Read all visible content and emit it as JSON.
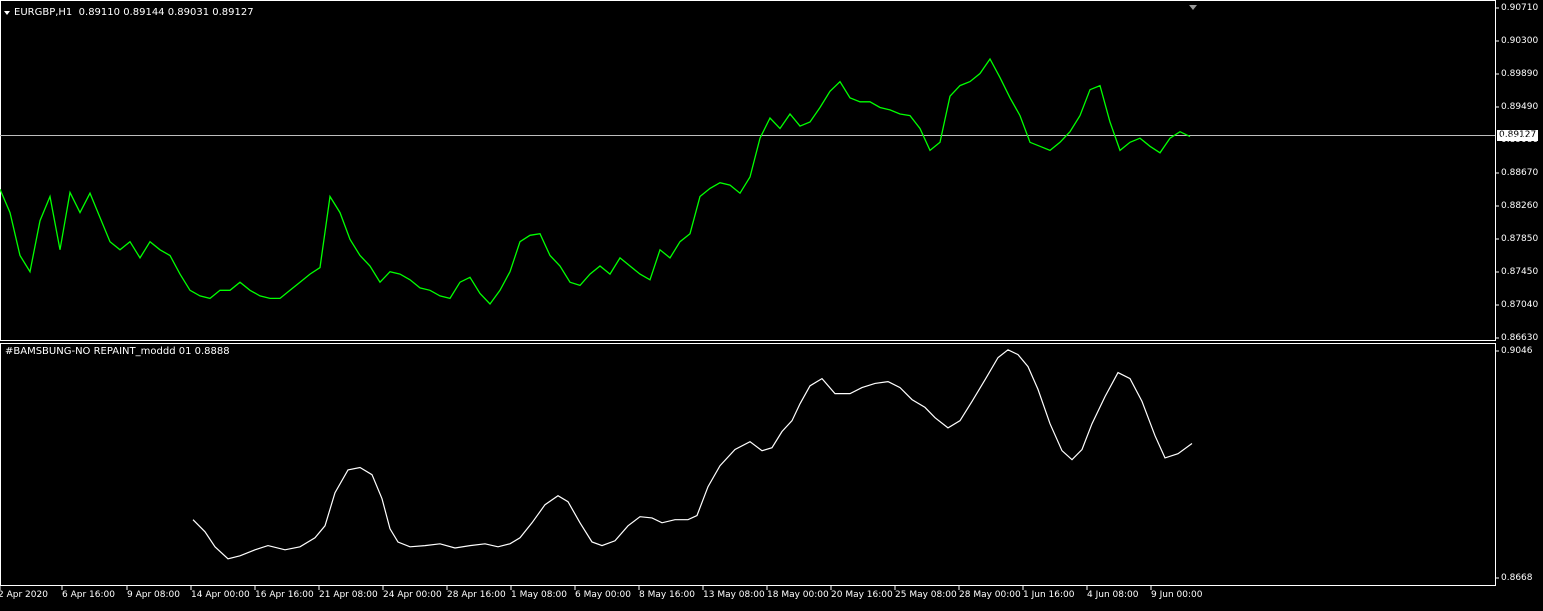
{
  "main_chart": {
    "symbol_tf": "EURGBP,H1",
    "ohlc": "0.89110 0.89144 0.89031 0.89127",
    "current_price": "0.89127",
    "colors": {
      "series": "#00ff00",
      "bg": "#000000",
      "grid": "#ffffff"
    }
  },
  "indicator": {
    "title": "#BAMSBUNG-NO REPAINT_moddd 01 0.8888",
    "color": "#ffffff"
  },
  "chart_data": [
    {
      "type": "line",
      "title": "EURGBP,H1",
      "ylim": [
        0.8663,
        0.9071
      ],
      "yticks": [
        "0.90710",
        "0.90300",
        "0.89890",
        "0.89490",
        "0.89080",
        "0.88670",
        "0.88260",
        "0.87850",
        "0.87450",
        "0.87040",
        "0.86630"
      ],
      "series": [
        {
          "name": "EURGBP,H1",
          "x": [
            0,
            10,
            20,
            30,
            40,
            50,
            60,
            70,
            80,
            90,
            100,
            110,
            120,
            130,
            140,
            150,
            160,
            170,
            180,
            190,
            200,
            210,
            220,
            230,
            240,
            250,
            260,
            270,
            280,
            290,
            300,
            310,
            320,
            330,
            340,
            350,
            360,
            370,
            380,
            390,
            400,
            410,
            420,
            430,
            440,
            450,
            460,
            470,
            480,
            490,
            500,
            510,
            520,
            530,
            540,
            550,
            560,
            570,
            580,
            590,
            600,
            610,
            620,
            630,
            640,
            650,
            660,
            670,
            680,
            690,
            700,
            710,
            720,
            730,
            740,
            750,
            760,
            770,
            780,
            790,
            800,
            810,
            820,
            830,
            840,
            850,
            860,
            870,
            880,
            890,
            900,
            910,
            920,
            930,
            940,
            950,
            960,
            970,
            980,
            990,
            1000,
            1010,
            1020,
            1030,
            1040,
            1050,
            1060,
            1070,
            1080,
            1090,
            1100,
            1110,
            1120,
            1130,
            1140,
            1150,
            1160,
            1170,
            1180,
            1190
          ],
          "values": [
            0.8847,
            0.8818,
            0.8765,
            0.8745,
            0.8808,
            0.8838,
            0.8772,
            0.8843,
            0.8818,
            0.8842,
            0.8812,
            0.8782,
            0.8772,
            0.8782,
            0.8762,
            0.8782,
            0.8772,
            0.8765,
            0.8742,
            0.8722,
            0.8715,
            0.8712,
            0.8722,
            0.8722,
            0.8732,
            0.8722,
            0.8715,
            0.8712,
            0.8712,
            0.8722,
            0.8732,
            0.8742,
            0.875,
            0.8838,
            0.8818,
            0.8785,
            0.8765,
            0.8752,
            0.8732,
            0.8745,
            0.8742,
            0.8735,
            0.8725,
            0.8722,
            0.8715,
            0.8712,
            0.8732,
            0.8738,
            0.8718,
            0.8705,
            0.8722,
            0.8745,
            0.8782,
            0.879,
            0.8792,
            0.8765,
            0.8752,
            0.8732,
            0.8728,
            0.8742,
            0.8752,
            0.8742,
            0.8762,
            0.8752,
            0.8742,
            0.8735,
            0.8772,
            0.8762,
            0.8782,
            0.8792,
            0.8838,
            0.8848,
            0.8855,
            0.8852,
            0.8842,
            0.8862,
            0.891,
            0.8935,
            0.8922,
            0.894,
            0.8925,
            0.893,
            0.8948,
            0.8968,
            0.898,
            0.896,
            0.8955,
            0.8955,
            0.8948,
            0.8945,
            0.894,
            0.8938,
            0.8922,
            0.8895,
            0.8905,
            0.8962,
            0.8975,
            0.898,
            0.899,
            0.9008,
            0.8985,
            0.896,
            0.8938,
            0.8905,
            0.89,
            0.8895,
            0.8905,
            0.8918,
            0.8938,
            0.897,
            0.8975,
            0.893,
            0.8895,
            0.8905,
            0.891,
            0.89,
            0.8892,
            0.891,
            0.8918,
            0.8912
          ]
        }
      ]
    },
    {
      "type": "line",
      "title": "#BAMSBUNG-NO REPAINT_moddd 01 0.8888",
      "ylim": [
        0.8668,
        0.9046
      ],
      "yticks": [
        "0.9046",
        "0.8668"
      ],
      "xticks": [
        "2 Apr 2020",
        "6 Apr 16:00",
        "9 Apr 08:00",
        "14 Apr 00:00",
        "16 Apr 16:00",
        "21 Apr 08:00",
        "24 Apr 00:00",
        "28 Apr 16:00",
        "1 May 08:00",
        "6 May 00:00",
        "8 May 16:00",
        "13 May 08:00",
        "18 May 00:00",
        "20 May 16:00",
        "25 May 08:00",
        "28 May 00:00",
        "1 Jun 16:00",
        "4 Jun 08:00",
        "9 Jun 00:00"
      ],
      "series": [
        {
          "name": "#BAMSBUNG-NO REPAINT_moddd 01",
          "x": [
            193,
            205,
            215,
            228,
            240,
            255,
            268,
            285,
            300,
            315,
            325,
            335,
            348,
            360,
            372,
            382,
            390,
            398,
            410,
            425,
            440,
            455,
            470,
            485,
            498,
            510,
            520,
            532,
            545,
            558,
            568,
            580,
            592,
            602,
            615,
            628,
            640,
            652,
            662,
            675,
            688,
            697,
            708,
            720,
            735,
            750,
            762,
            772,
            782,
            792,
            800,
            810,
            822,
            835,
            850,
            862,
            875,
            888,
            900,
            912,
            925,
            935,
            948,
            960,
            972,
            985,
            998,
            1008,
            1018,
            1028,
            1038,
            1050,
            1062,
            1072,
            1082,
            1092,
            1105,
            1118,
            1130,
            1142,
            1155,
            1165,
            1178,
            1192
          ],
          "values": [
            0.8765,
            0.8745,
            0.872,
            0.87,
            0.8705,
            0.8715,
            0.8722,
            0.8715,
            0.872,
            0.8735,
            0.8755,
            0.881,
            0.8848,
            0.8852,
            0.884,
            0.88,
            0.875,
            0.8728,
            0.872,
            0.8722,
            0.8725,
            0.8718,
            0.8722,
            0.8725,
            0.872,
            0.8725,
            0.8735,
            0.876,
            0.879,
            0.8805,
            0.8795,
            0.876,
            0.8728,
            0.8722,
            0.873,
            0.8755,
            0.877,
            0.8768,
            0.876,
            0.8765,
            0.8765,
            0.8772,
            0.882,
            0.8855,
            0.8882,
            0.8895,
            0.888,
            0.8885,
            0.8912,
            0.893,
            0.8958,
            0.8988,
            0.9,
            0.8975,
            0.8975,
            0.8985,
            0.8992,
            0.8995,
            0.8985,
            0.8965,
            0.8952,
            0.8935,
            0.8918,
            0.893,
            0.8962,
            0.8998,
            0.9035,
            0.9048,
            0.904,
            0.902,
            0.8982,
            0.8925,
            0.888,
            0.8865,
            0.8882,
            0.8925,
            0.897,
            0.901,
            0.9,
            0.8962,
            0.8905,
            0.8868,
            0.8875,
            0.8892
          ]
        }
      ]
    }
  ]
}
